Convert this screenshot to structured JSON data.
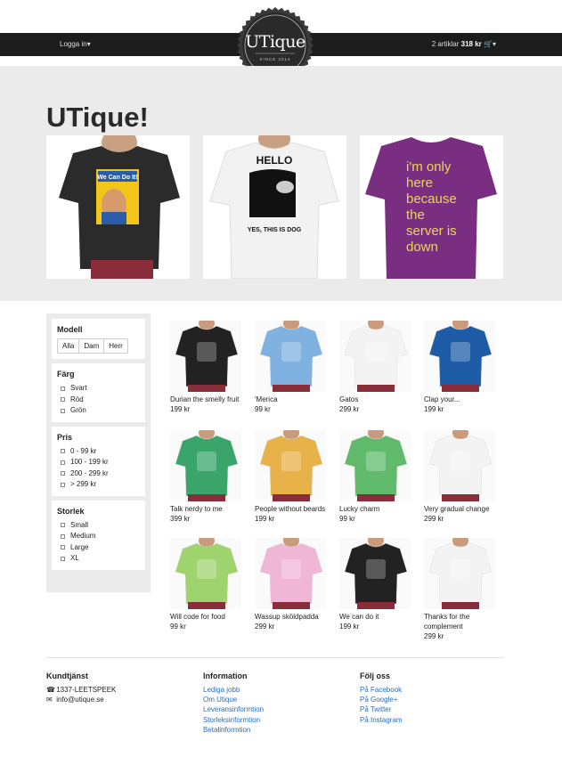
{
  "header": {
    "login_label": "Logga in",
    "login_caret": "▾",
    "cart_prefix": "2 artiklar",
    "cart_total": "318 kr",
    "cart_icon": "cart-icon",
    "logo_name": "UTique",
    "logo_since": "SINCE 2014"
  },
  "hero": {
    "title": "UTique!",
    "images": [
      {
        "shirt_color": "#2b2b2b",
        "label": "We Can Do It!",
        "text_color": "#f4c51a"
      },
      {
        "shirt_color": "#f2f2f2",
        "label": "HELLO / YES, THIS IS DOG",
        "text_color": "#111111"
      },
      {
        "shirt_color": "#7a2e82",
        "label": "I'm only here because the server is down",
        "text_color": "#e8d94f"
      }
    ]
  },
  "filters": {
    "model": {
      "title": "Modell",
      "options": [
        "Alla",
        "Dam",
        "Herr"
      ]
    },
    "color": {
      "title": "Färg",
      "options": [
        "Svart",
        "Röd",
        "Grön"
      ]
    },
    "price": {
      "title": "Pris",
      "options": [
        "0 - 99 kr",
        "100 - 199 kr",
        "200 - 299 kr",
        "> 299 kr"
      ]
    },
    "size": {
      "title": "Storlek",
      "options": [
        "Small",
        "Medium",
        "Large",
        "XL"
      ]
    }
  },
  "products": [
    {
      "name": "Durian the smelly fruit",
      "price": "199 kr",
      "shirt": "#222222"
    },
    {
      "name": "'Merica",
      "price": "99 kr",
      "shirt": "#7fb2e0"
    },
    {
      "name": "Gatos",
      "price": "299 kr",
      "shirt": "#f3f3f3"
    },
    {
      "name": "Clap your...",
      "price": "199 kr",
      "shirt": "#1f5ca8"
    },
    {
      "name": "Talk nerdy to me",
      "price": "399 kr",
      "shirt": "#3aa56b"
    },
    {
      "name": "People without beards",
      "price": "199 kr",
      "shirt": "#e8b24a"
    },
    {
      "name": "Lucky charm",
      "price": "99 kr",
      "shirt": "#5fba6b"
    },
    {
      "name": "Very gradual change",
      "price": "299 kr",
      "shirt": "#f3f3f3"
    },
    {
      "name": "Will code for food",
      "price": "99 kr",
      "shirt": "#9fd36e"
    },
    {
      "name": "Wassup sköldpadda",
      "price": "299 kr",
      "shirt": "#f0b6d6"
    },
    {
      "name": "We can do it",
      "price": "199 kr",
      "shirt": "#222222"
    },
    {
      "name": "Thanks for the complement",
      "price": "299 kr",
      "shirt": "#f3f3f3"
    }
  ],
  "footer": {
    "support": {
      "title": "Kundtjänst",
      "phone": "1337-LEETSPEEK",
      "email": "info@utique.se",
      "phone_icon": "phone-icon",
      "email_icon": "envelope-icon"
    },
    "info": {
      "title": "Information",
      "links": [
        "Lediga jobb",
        "Om Utique",
        "Leveransinformtion",
        "Storleksinformtion",
        "Betalinformtion"
      ]
    },
    "follow": {
      "title": "Följ oss",
      "links": [
        "På Facebook",
        "På Google+",
        "På Twitter",
        "På Instagram"
      ]
    }
  }
}
